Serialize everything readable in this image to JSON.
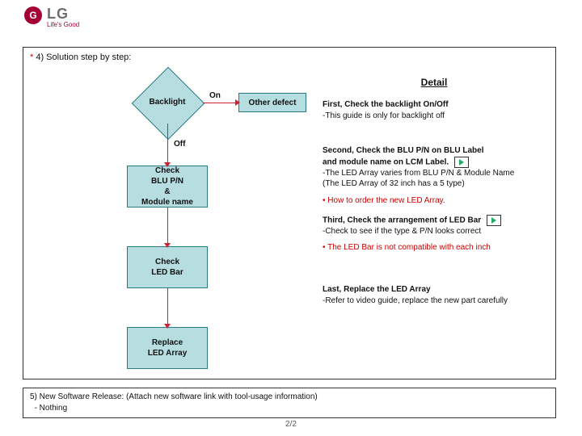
{
  "logo": {
    "mark": "G",
    "text": "LG",
    "sub": "Life's Good"
  },
  "section4": {
    "star": "*",
    "title": "4) Solution step by step:",
    "flow": {
      "backlight": "Backlight",
      "on": "On",
      "off": "Off",
      "other": "Other defect",
      "checkpn": "Check\nBLU P/N\n&\nModule name",
      "checkbar": "Check\nLED Bar",
      "replace": "Replace\nLED Array"
    },
    "detail": {
      "heading": "Detail",
      "first_t": "First, Check the backlight On/Off",
      "first_b": " -This guide is only for backlight off",
      "second_t": "Second, Check the BLU P/N on BLU Label\n and module name on LCM Label.",
      "second_b": " -The LED Array varies from BLU P/N & Module Name\n  (The LED Array of 32 inch has a 5 type)",
      "second_red": "• How to order the new LED Array.",
      "third_t": "Third, Check the arrangement of LED Bar",
      "third_b": " -Check to see if the type & P/N looks correct",
      "third_red": "• The LED Bar is not compatible with each inch",
      "last_t": "Last, Replace the LED Array",
      "last_b": " -Refer to video guide, replace the new part carefully"
    }
  },
  "section5": {
    "title": "5) New Software Release:",
    "sub": "(Attach new software link with tool-usage information)",
    "body": "- Nothing"
  },
  "page": "2/2"
}
